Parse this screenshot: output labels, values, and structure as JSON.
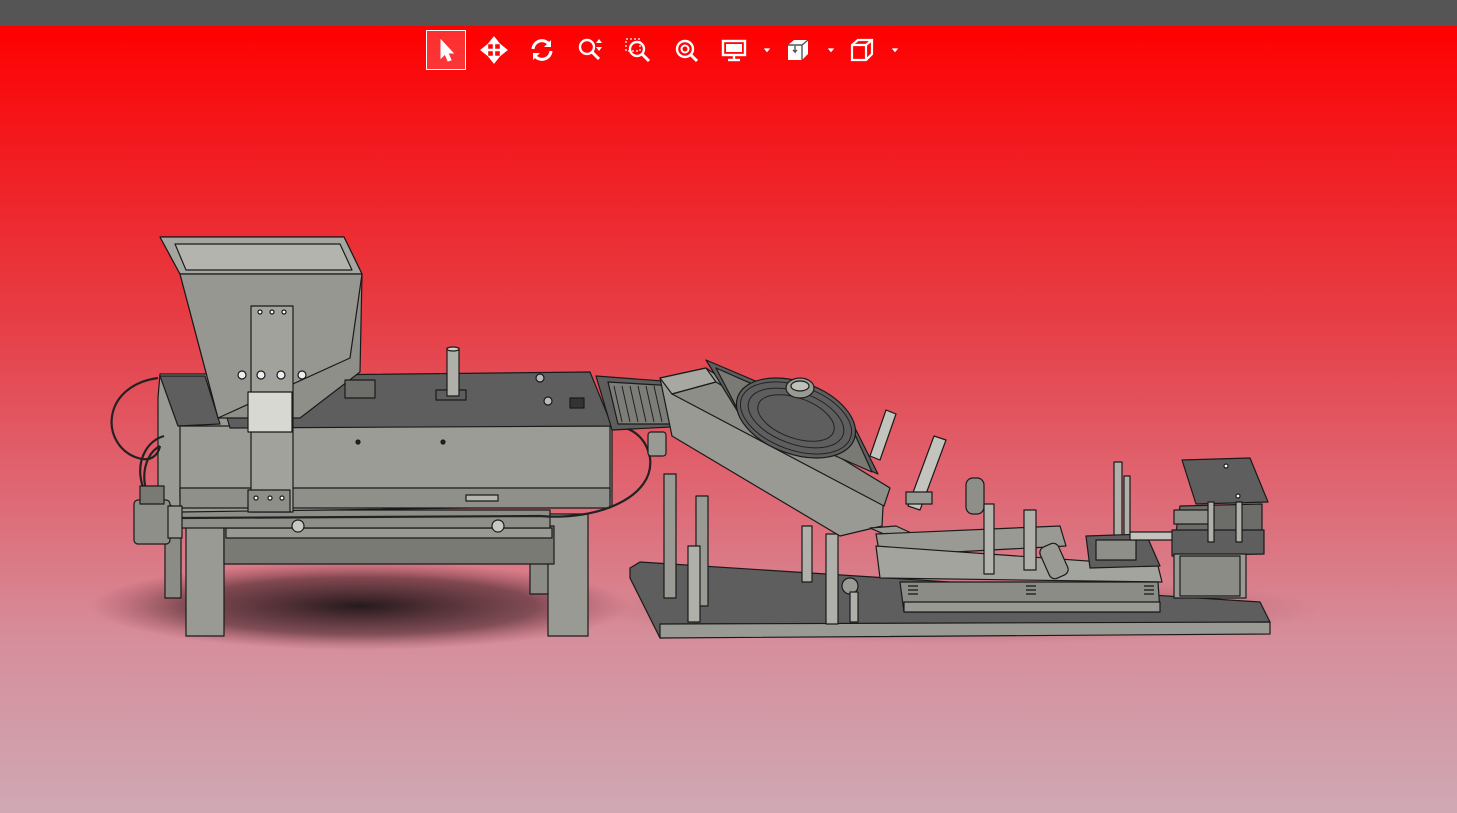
{
  "app": {
    "title": ""
  },
  "toolbar": {
    "tools": [
      {
        "id": "select",
        "icon": "arrow-pointer-icon",
        "active": true
      },
      {
        "id": "pan",
        "icon": "pan-arrows-icon",
        "active": false
      },
      {
        "id": "rotate",
        "icon": "rotate-icon",
        "active": false
      },
      {
        "id": "zoom",
        "icon": "zoom-updown-icon",
        "active": false
      },
      {
        "id": "zoom-window",
        "icon": "zoom-window-icon",
        "active": false
      },
      {
        "id": "zoom-fit",
        "icon": "zoom-fit-icon",
        "active": false
      },
      {
        "id": "display-style",
        "icon": "monitor-icon",
        "has_menu": true
      },
      {
        "id": "sections",
        "icon": "section-cube-icon",
        "has_menu": true
      },
      {
        "id": "views",
        "icon": "view-cube-icon",
        "has_menu": true
      }
    ]
  },
  "colors": {
    "background_top": "#ff0000",
    "background_bottom": "#cfa8b4",
    "title_bar": "#555555",
    "model_face": "#9a9a94",
    "model_dark": "#5e5e5e",
    "model_edge": "#1a1a1a"
  }
}
